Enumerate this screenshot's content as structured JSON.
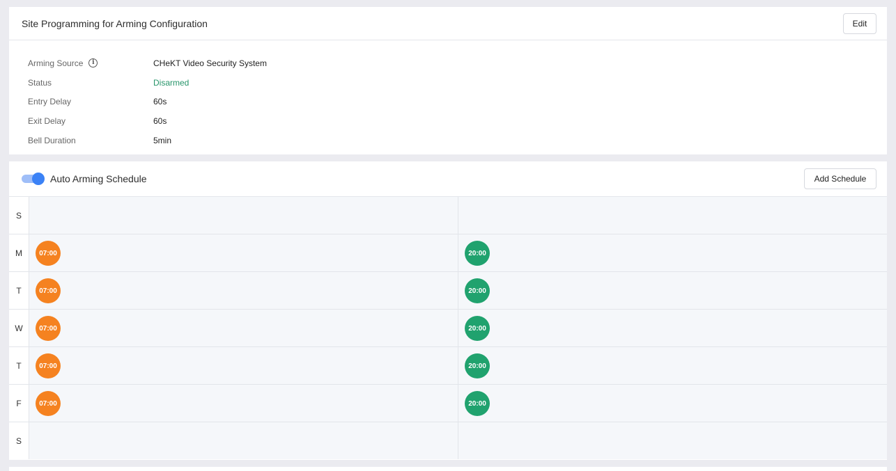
{
  "config": {
    "title": "Site Programming for Arming Configuration",
    "edit_label": "Edit",
    "rows": [
      {
        "label": "Arming Source",
        "value": "CHeKT Video Security System"
      },
      {
        "label": "Status",
        "value": "Disarmed"
      },
      {
        "label": "Entry Delay",
        "value": "60s"
      },
      {
        "label": "Exit Delay",
        "value": "60s"
      },
      {
        "label": "Bell Duration",
        "value": "5min"
      }
    ],
    "info_glyph": "i",
    "status_color": "#27956a"
  },
  "schedule": {
    "title": "Auto Arming Schedule",
    "enabled": true,
    "add_label": "Add Schedule",
    "colors": {
      "arm": "#f58220",
      "disarm": "#20a26e"
    },
    "days": [
      {
        "day": "S",
        "arm": "",
        "disarm": ""
      },
      {
        "day": "M",
        "arm": "07:00",
        "disarm": "20:00"
      },
      {
        "day": "T",
        "arm": "07:00",
        "disarm": "20:00"
      },
      {
        "day": "W",
        "arm": "07:00",
        "disarm": "20:00"
      },
      {
        "day": "T",
        "arm": "07:00",
        "disarm": "20:00"
      },
      {
        "day": "F",
        "arm": "07:00",
        "disarm": "20:00"
      },
      {
        "day": "S",
        "arm": "",
        "disarm": ""
      }
    ]
  }
}
